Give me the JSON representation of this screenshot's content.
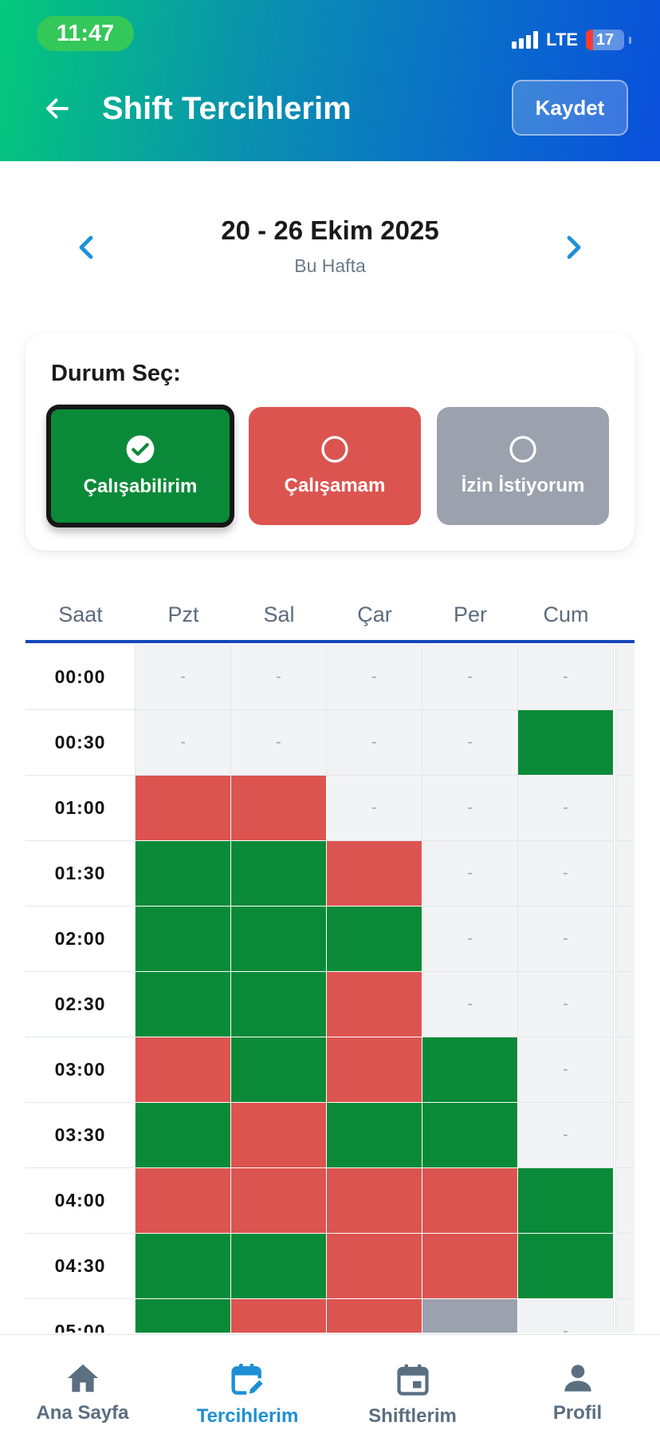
{
  "status_bar": {
    "time": "11:47",
    "network": "LTE",
    "battery": "17"
  },
  "header": {
    "title": "Shift Tercihlerim",
    "save_label": "Kaydet",
    "back_icon": "arrow-left-icon"
  },
  "week": {
    "title": "20 - 26 Ekim 2025",
    "subtitle": "Bu Hafta"
  },
  "status_picker": {
    "title": "Durum Seç:",
    "options": [
      {
        "label": "Çalışabilirim",
        "state": "selected",
        "color": "#0a8a38"
      },
      {
        "label": "Çalışamam",
        "state": "unselected",
        "color": "#dc5450"
      },
      {
        "label": "İzin İstiyorum",
        "state": "unselected",
        "color": "#9ba1ad"
      }
    ]
  },
  "schedule": {
    "columns": [
      "Saat",
      "Pzt",
      "Sal",
      "Çar",
      "Per",
      "Cum"
    ],
    "empty_symbol": "-",
    "rows": [
      {
        "time": "00:00",
        "cells": [
          "-",
          "-",
          "-",
          "-",
          "-"
        ]
      },
      {
        "time": "00:30",
        "cells": [
          "-",
          "-",
          "-",
          "-",
          "available"
        ]
      },
      {
        "time": "01:00",
        "cells": [
          "unavailable",
          "unavailable",
          "-",
          "-",
          "-"
        ]
      },
      {
        "time": "01:30",
        "cells": [
          "available",
          "available",
          "unavailable",
          "-",
          "-"
        ]
      },
      {
        "time": "02:00",
        "cells": [
          "available",
          "available",
          "available",
          "-",
          "-"
        ]
      },
      {
        "time": "02:30",
        "cells": [
          "available",
          "available",
          "unavailable",
          "-",
          "-"
        ]
      },
      {
        "time": "03:00",
        "cells": [
          "unavailable",
          "available",
          "unavailable",
          "available",
          "-"
        ]
      },
      {
        "time": "03:30",
        "cells": [
          "available",
          "unavailable",
          "available",
          "available",
          "-"
        ]
      },
      {
        "time": "04:00",
        "cells": [
          "unavailable",
          "unavailable",
          "unavailable",
          "unavailable",
          "available"
        ]
      },
      {
        "time": "04:30",
        "cells": [
          "available",
          "available",
          "unavailable",
          "unavailable",
          "available"
        ]
      },
      {
        "time": "05:00",
        "cells": [
          "available",
          "unavailable",
          "unavailable",
          "leave",
          "-"
        ]
      }
    ],
    "colors": {
      "available": "#0a8a38",
      "unavailable": "#dc5450",
      "leave": "#9ba1ad",
      "empty": "#f2f3f5"
    }
  },
  "bottom_nav": {
    "items": [
      {
        "label": "Ana Sayfa",
        "icon": "home-icon",
        "active": false
      },
      {
        "label": "Tercihlerim",
        "icon": "calendar-edit-icon",
        "active": true
      },
      {
        "label": "Shiftlerim",
        "icon": "calendar-icon",
        "active": false
      },
      {
        "label": "Profil",
        "icon": "person-icon",
        "active": false
      }
    ]
  }
}
